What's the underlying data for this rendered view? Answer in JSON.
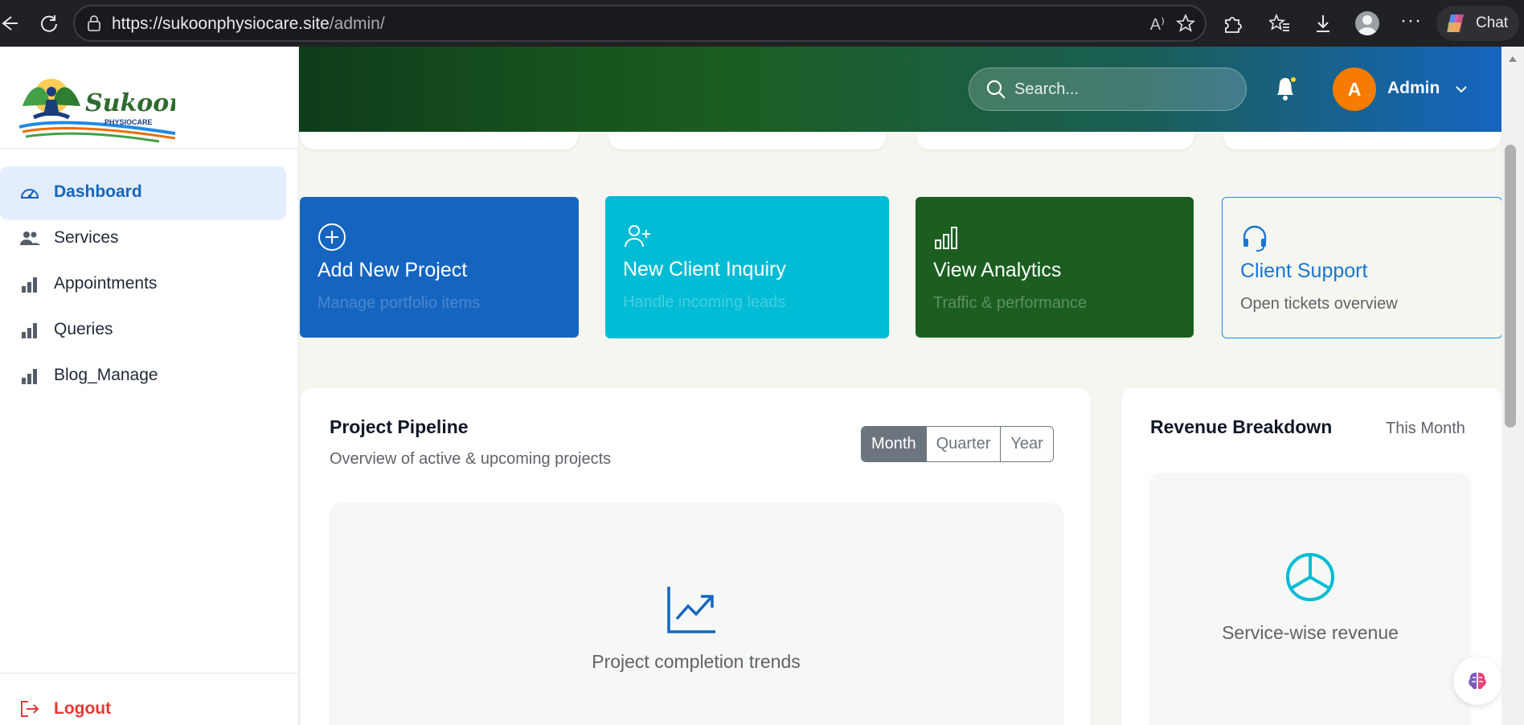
{
  "browser": {
    "url_host": "https://sukoonphysiocare.site",
    "url_path": "/admin/",
    "read_aloud": "A⁾",
    "more": "···",
    "chat_label": "Chat",
    "icons": [
      "back-icon",
      "reload-icon",
      "lock-icon",
      "read-aloud-icon",
      "favorite-star-icon",
      "extensions-icon",
      "favorites-icon",
      "download-icon",
      "profile-icon",
      "more-icon",
      "copilot-icon"
    ]
  },
  "sidebar": {
    "logo_text": "Sukoon",
    "logo_subtext": "PHYSIOCARE",
    "items": [
      {
        "label": "Dashboard",
        "icon": "gauge-icon",
        "active": true
      },
      {
        "label": "Services",
        "icon": "users-icon",
        "active": false
      },
      {
        "label": "Appointments",
        "icon": "bar-chart-icon",
        "active": false
      },
      {
        "label": "Queries",
        "icon": "bar-chart-icon",
        "active": false
      },
      {
        "label": "Blog_Manage",
        "icon": "bar-chart-icon",
        "active": false
      }
    ],
    "logout_label": "Logout"
  },
  "header": {
    "search_placeholder": "Search...",
    "avatar_initial": "A",
    "user_name": "Admin"
  },
  "actions": [
    {
      "title": "Add New Project",
      "subtitle": "Manage portfolio items",
      "icon": "plus-circle-icon",
      "color": "#1565c0"
    },
    {
      "title": "New Client Inquiry",
      "subtitle": "Handle incoming leads",
      "icon": "person-plus-icon",
      "color": "#00bcd4"
    },
    {
      "title": "View Analytics",
      "subtitle": "Traffic & performance",
      "icon": "bar-chart-icon",
      "color": "#1b5e20"
    },
    {
      "title": "Client Support",
      "subtitle": "Open tickets overview",
      "icon": "headset-icon",
      "color": "#1976d2"
    }
  ],
  "pipeline": {
    "title": "Project Pipeline",
    "subtitle": "Overview of active & upcoming projects",
    "periods": [
      "Month",
      "Quarter",
      "Year"
    ],
    "selected_period": "Month",
    "placeholder": "Project completion trends"
  },
  "revenue": {
    "title": "Revenue Breakdown",
    "period": "This Month",
    "placeholder": "Service-wise revenue"
  },
  "colors": {
    "primary": "#1565c0",
    "cyan": "#00bcd4",
    "green": "#1b5e20",
    "logout": "#e53935",
    "avatar": "#f57c00"
  }
}
